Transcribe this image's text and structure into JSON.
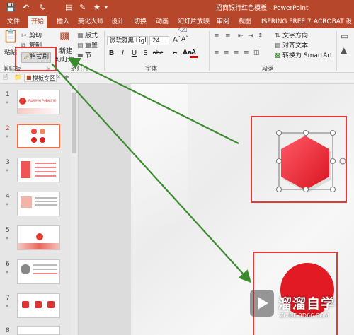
{
  "window": {
    "title": "招商银行红色模板 - PowerPoint"
  },
  "tabs": [
    "文件",
    "开始",
    "插入",
    "美化大师",
    "设计",
    "切换",
    "动画",
    "幻灯片放映",
    "审阅",
    "视图",
    "ISPRING FREE 7",
    "ACROBAT",
    "设"
  ],
  "active_tab": "开始",
  "clipboard": {
    "paste": "粘贴",
    "cut": "剪切",
    "copy": "复制",
    "format_painter": "格式刷",
    "group": "剪贴板"
  },
  "slides_group": {
    "new_slide_1": "新建",
    "new_slide_2": "幻灯片",
    "layout": "版式",
    "reset": "重置",
    "section": "节",
    "group": "幻灯片"
  },
  "font": {
    "name": "微软雅黑 Ligl",
    "size": "24",
    "group": "字体",
    "bold": "B",
    "italic": "I",
    "underline": "U",
    "strike": "S",
    "shadow": "abc",
    "color": "A"
  },
  "paragraph": {
    "text_direction": "文字方向",
    "align_text": "对齐文本",
    "smartart": "转换为 SmartArt",
    "group": "段落"
  },
  "strip": {
    "tab_name": "模板专区",
    "add": "+"
  },
  "thumbnails": [
    {
      "num": "1",
      "star": "*",
      "caption": "招商银行红色模板汇报"
    },
    {
      "num": "2",
      "star": "*",
      "selected": true
    },
    {
      "num": "3",
      "star": "*"
    },
    {
      "num": "4",
      "star": "*"
    },
    {
      "num": "5",
      "star": "*"
    },
    {
      "num": "6",
      "star": "*"
    },
    {
      "num": "7",
      "star": "*"
    },
    {
      "num": "8",
      "star": ""
    }
  ],
  "watermark": {
    "main": "溜溜自学",
    "sub": "ZIXUE.3D66.COM"
  },
  "colors": {
    "accent": "#b7472a",
    "shape_red": "#e0252f",
    "highlight_box": "#e53935",
    "arrow": "#3a8a2e"
  }
}
